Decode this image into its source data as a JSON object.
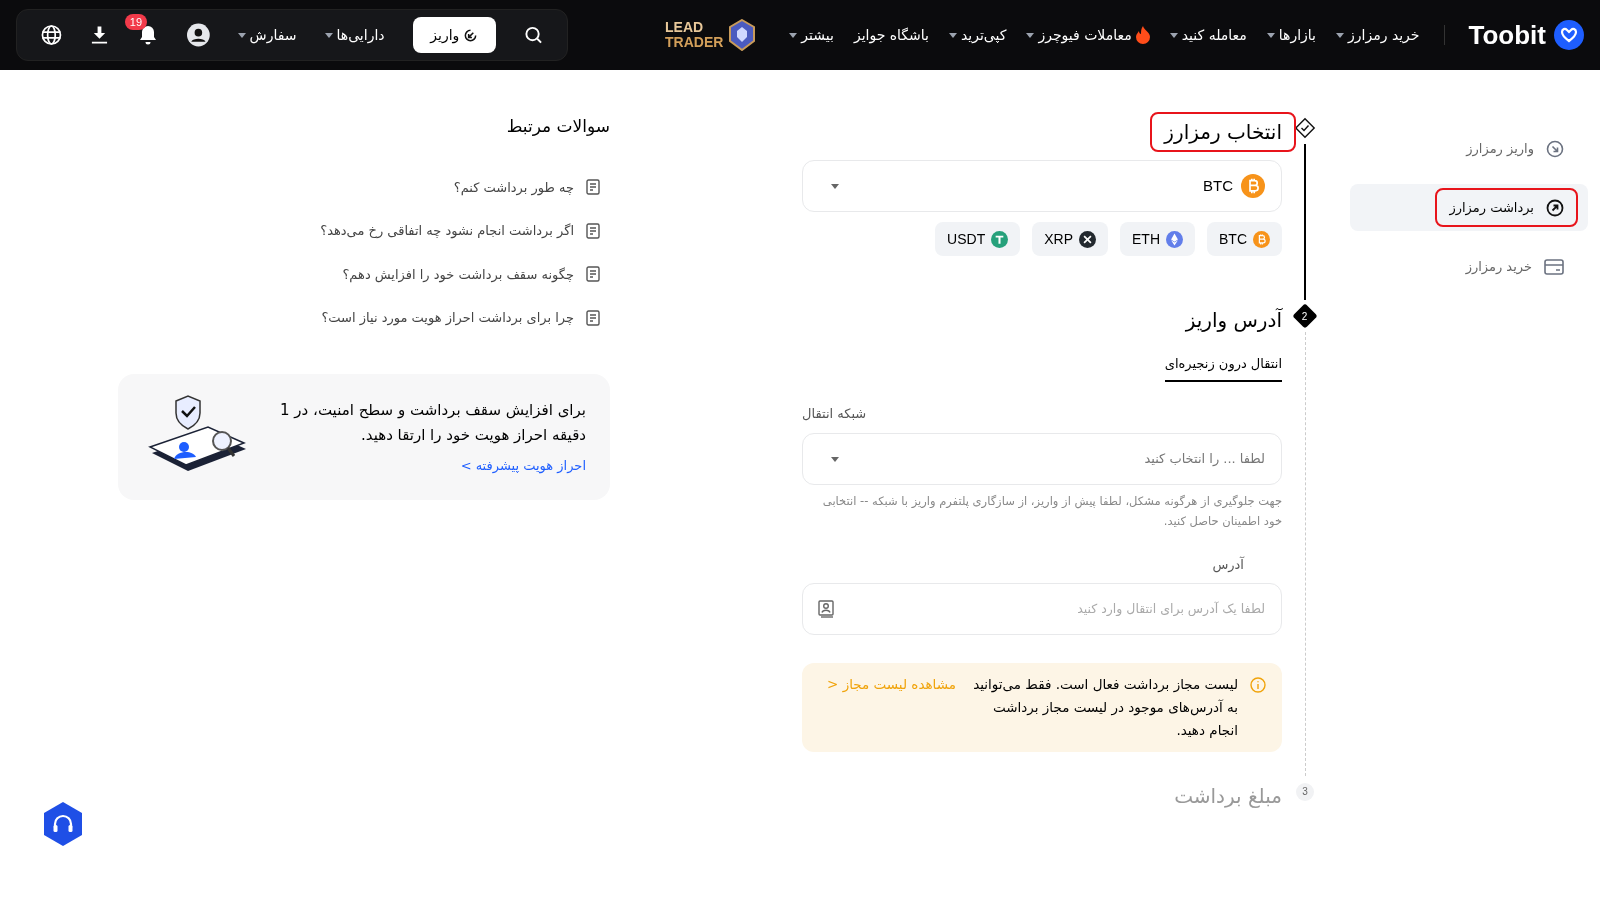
{
  "header": {
    "logo": "Toobit",
    "nav": [
      {
        "label": "خرید رمزارز",
        "dropdown": true,
        "hot": false
      },
      {
        "label": "بازارها",
        "dropdown": true,
        "hot": false
      },
      {
        "label": "معامله کنید",
        "dropdown": true,
        "hot": false
      },
      {
        "label": "معاملات فیوچرز",
        "dropdown": true,
        "hot": true
      },
      {
        "label": "کپی‌ترید",
        "dropdown": true,
        "hot": false
      },
      {
        "label": "باشگاه جوایز",
        "dropdown": false,
        "hot": false
      },
      {
        "label": "بیشتر",
        "dropdown": true,
        "hot": false
      }
    ],
    "lead_trader": [
      "LEAD",
      "TRADER"
    ],
    "deposit_button": "واریز",
    "menus": [
      "دارایی‌ها",
      "سفارش"
    ],
    "notification_count": "19"
  },
  "sidebar": {
    "items": [
      {
        "label": "واریز رمزارز",
        "kind": "deposit",
        "selected": false,
        "highlighted": false
      },
      {
        "label": "برداشت رمزارز",
        "kind": "withdraw",
        "selected": true,
        "highlighted": true
      },
      {
        "label": "خرید رمزارز",
        "kind": "card",
        "selected": false,
        "highlighted": false
      }
    ]
  },
  "steps": [
    {
      "kind": "done",
      "title": "انتخاب رمزارز",
      "highlighted": true,
      "coin_select": {
        "value": "BTC",
        "kind": "btc"
      },
      "chips": [
        {
          "symbol": "BTC",
          "kind": "btc"
        },
        {
          "symbol": "ETH",
          "kind": "eth"
        },
        {
          "symbol": "XRP",
          "kind": "xrp"
        },
        {
          "symbol": "USDT",
          "kind": "usdt"
        }
      ]
    },
    {
      "kind": "active",
      "number": "2",
      "title": "آدرس واریز",
      "highlighted": false,
      "tabs": [
        {
          "label": "انتقال درون زنجیره‌ای",
          "selected": true
        }
      ],
      "network": {
        "label": "شبکه انتقال",
        "placeholder": "لطفا ... را انتخاب کنید",
        "hint": "جهت جلوگیری از هرگونه مشکل، لطفا پیش از واریز، از سازگاری پلتفرم واریز با شبکه -- انتخابی خود اطمینان حاصل کنید."
      },
      "address": {
        "label": "آدرس",
        "placeholder": "لطفا یک آدرس برای انتقال وارد کنید"
      },
      "alert": {
        "text": "لیست مجاز برداشت فعال است. فقط می‌توانید به آدرس‌های موجود در لیست مجاز برداشت انجام دهید.",
        "link": "مشاهده لیست مجاز <"
      }
    },
    {
      "kind": "pending",
      "number": "3",
      "title": "مبلغ برداشت",
      "highlighted": false
    }
  ],
  "faq": {
    "title": "سوالات مرتبط",
    "items": [
      "چه طور برداشت کنم؟",
      "اگر برداشت انجام نشود چه اتفاقی رخ می‌دهد؟",
      "چگونه سقف برداشت خود را افزایش دهم؟",
      "چرا برای برداشت احراز هویت مورد نیاز است؟"
    ],
    "promo": {
      "text": "برای افزایش سقف برداشت و سطح امنیت، در 1 دقیقه احراز هویت خود را ارتقا دهید.",
      "link": "احراز هویت پیشرفته >"
    }
  }
}
